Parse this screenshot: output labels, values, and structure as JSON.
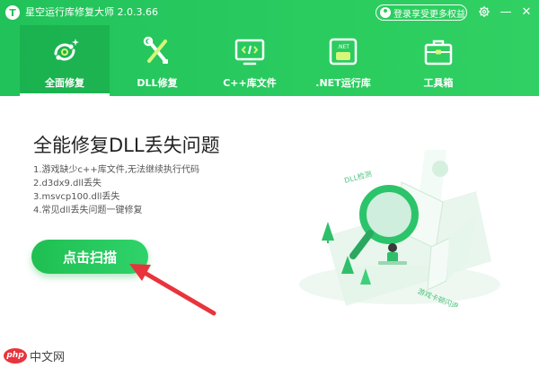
{
  "app": {
    "title": "星空运行库修复大师 2.0.3.66",
    "logo_glyph": "T",
    "login_label": "登录享受更多权益"
  },
  "window_controls": {
    "settings_icon": "gear-icon",
    "minimize_glyph": "—",
    "close_glyph": "✕"
  },
  "nav": {
    "tabs": [
      {
        "label": "全面修复",
        "icon": "refresh-repair-icon",
        "active": true
      },
      {
        "label": "DLL修复",
        "icon": "wrench-screwdriver-icon",
        "active": false
      },
      {
        "label": "C++库文件",
        "icon": "code-monitor-icon",
        "active": false
      },
      {
        "label": ".NET运行库",
        "icon": "net-framework-icon",
        "active": false
      },
      {
        "label": "工具箱",
        "icon": "toolbox-icon",
        "active": false
      }
    ]
  },
  "main": {
    "title": "全能修复DLL丢失问题",
    "tips": [
      "1.游戏缺少c++库文件,无法继续执行代码",
      "2.d3dx9.dll丢失",
      "3.msvcp100.dll丢失",
      "4.常见dll丢失问题一键修复"
    ],
    "scan_button": "点击扫描",
    "illustration": {
      "label_top": "DLL检测",
      "label_bottom": "游戏卡顿闪退"
    }
  },
  "watermark": {
    "logo": "php",
    "text": "中文网"
  },
  "colors": {
    "brand_green": "#27c95f",
    "arrow_red": "#e8343c"
  }
}
